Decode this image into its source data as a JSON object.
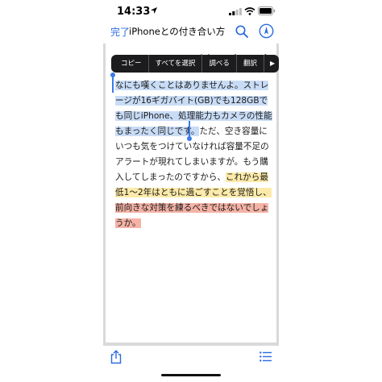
{
  "status_bar": {
    "time": "14:33",
    "icons": [
      "location-arrow-icon",
      "signal-icon",
      "wifi-icon",
      "battery-icon"
    ]
  },
  "nav": {
    "done_label": "完了",
    "title": "iPhoneとの付き合い方（12…",
    "icons": [
      "search-icon",
      "safari-icon"
    ]
  },
  "article": {
    "heading_partial": "iPhoneとの付き合い方",
    "selected_text": "なにも嘆くことはありませんよ。ストレージが16ギガバイト(GB)でも128GBでも同じiPhone、処理能力もカメラの性能もまったく同じです。",
    "plain_text": "ただ、空き容量にいつも気をつけていなければ容量不足のアラートが現れてしまいますが。もう購入してしまったのですから、",
    "yellow_text": "これから最低1〜2年はともに過ごすことを覚悟し、",
    "red_text": "前向きな対策を練るべきではないでしょうか。"
  },
  "callout_menu": {
    "items": [
      "コピー",
      "すべてを選択",
      "調べる",
      "翻訳"
    ],
    "more": "▶"
  },
  "toolbar": {
    "icons": [
      "share-icon",
      "list-icon"
    ]
  },
  "colors": {
    "accent": "#2a6be0",
    "selection": "#c9dcf6",
    "highlight_yellow": "#fbeaa9",
    "highlight_red": "#f4b3a6",
    "menu_bg": "#1c1c1e"
  }
}
